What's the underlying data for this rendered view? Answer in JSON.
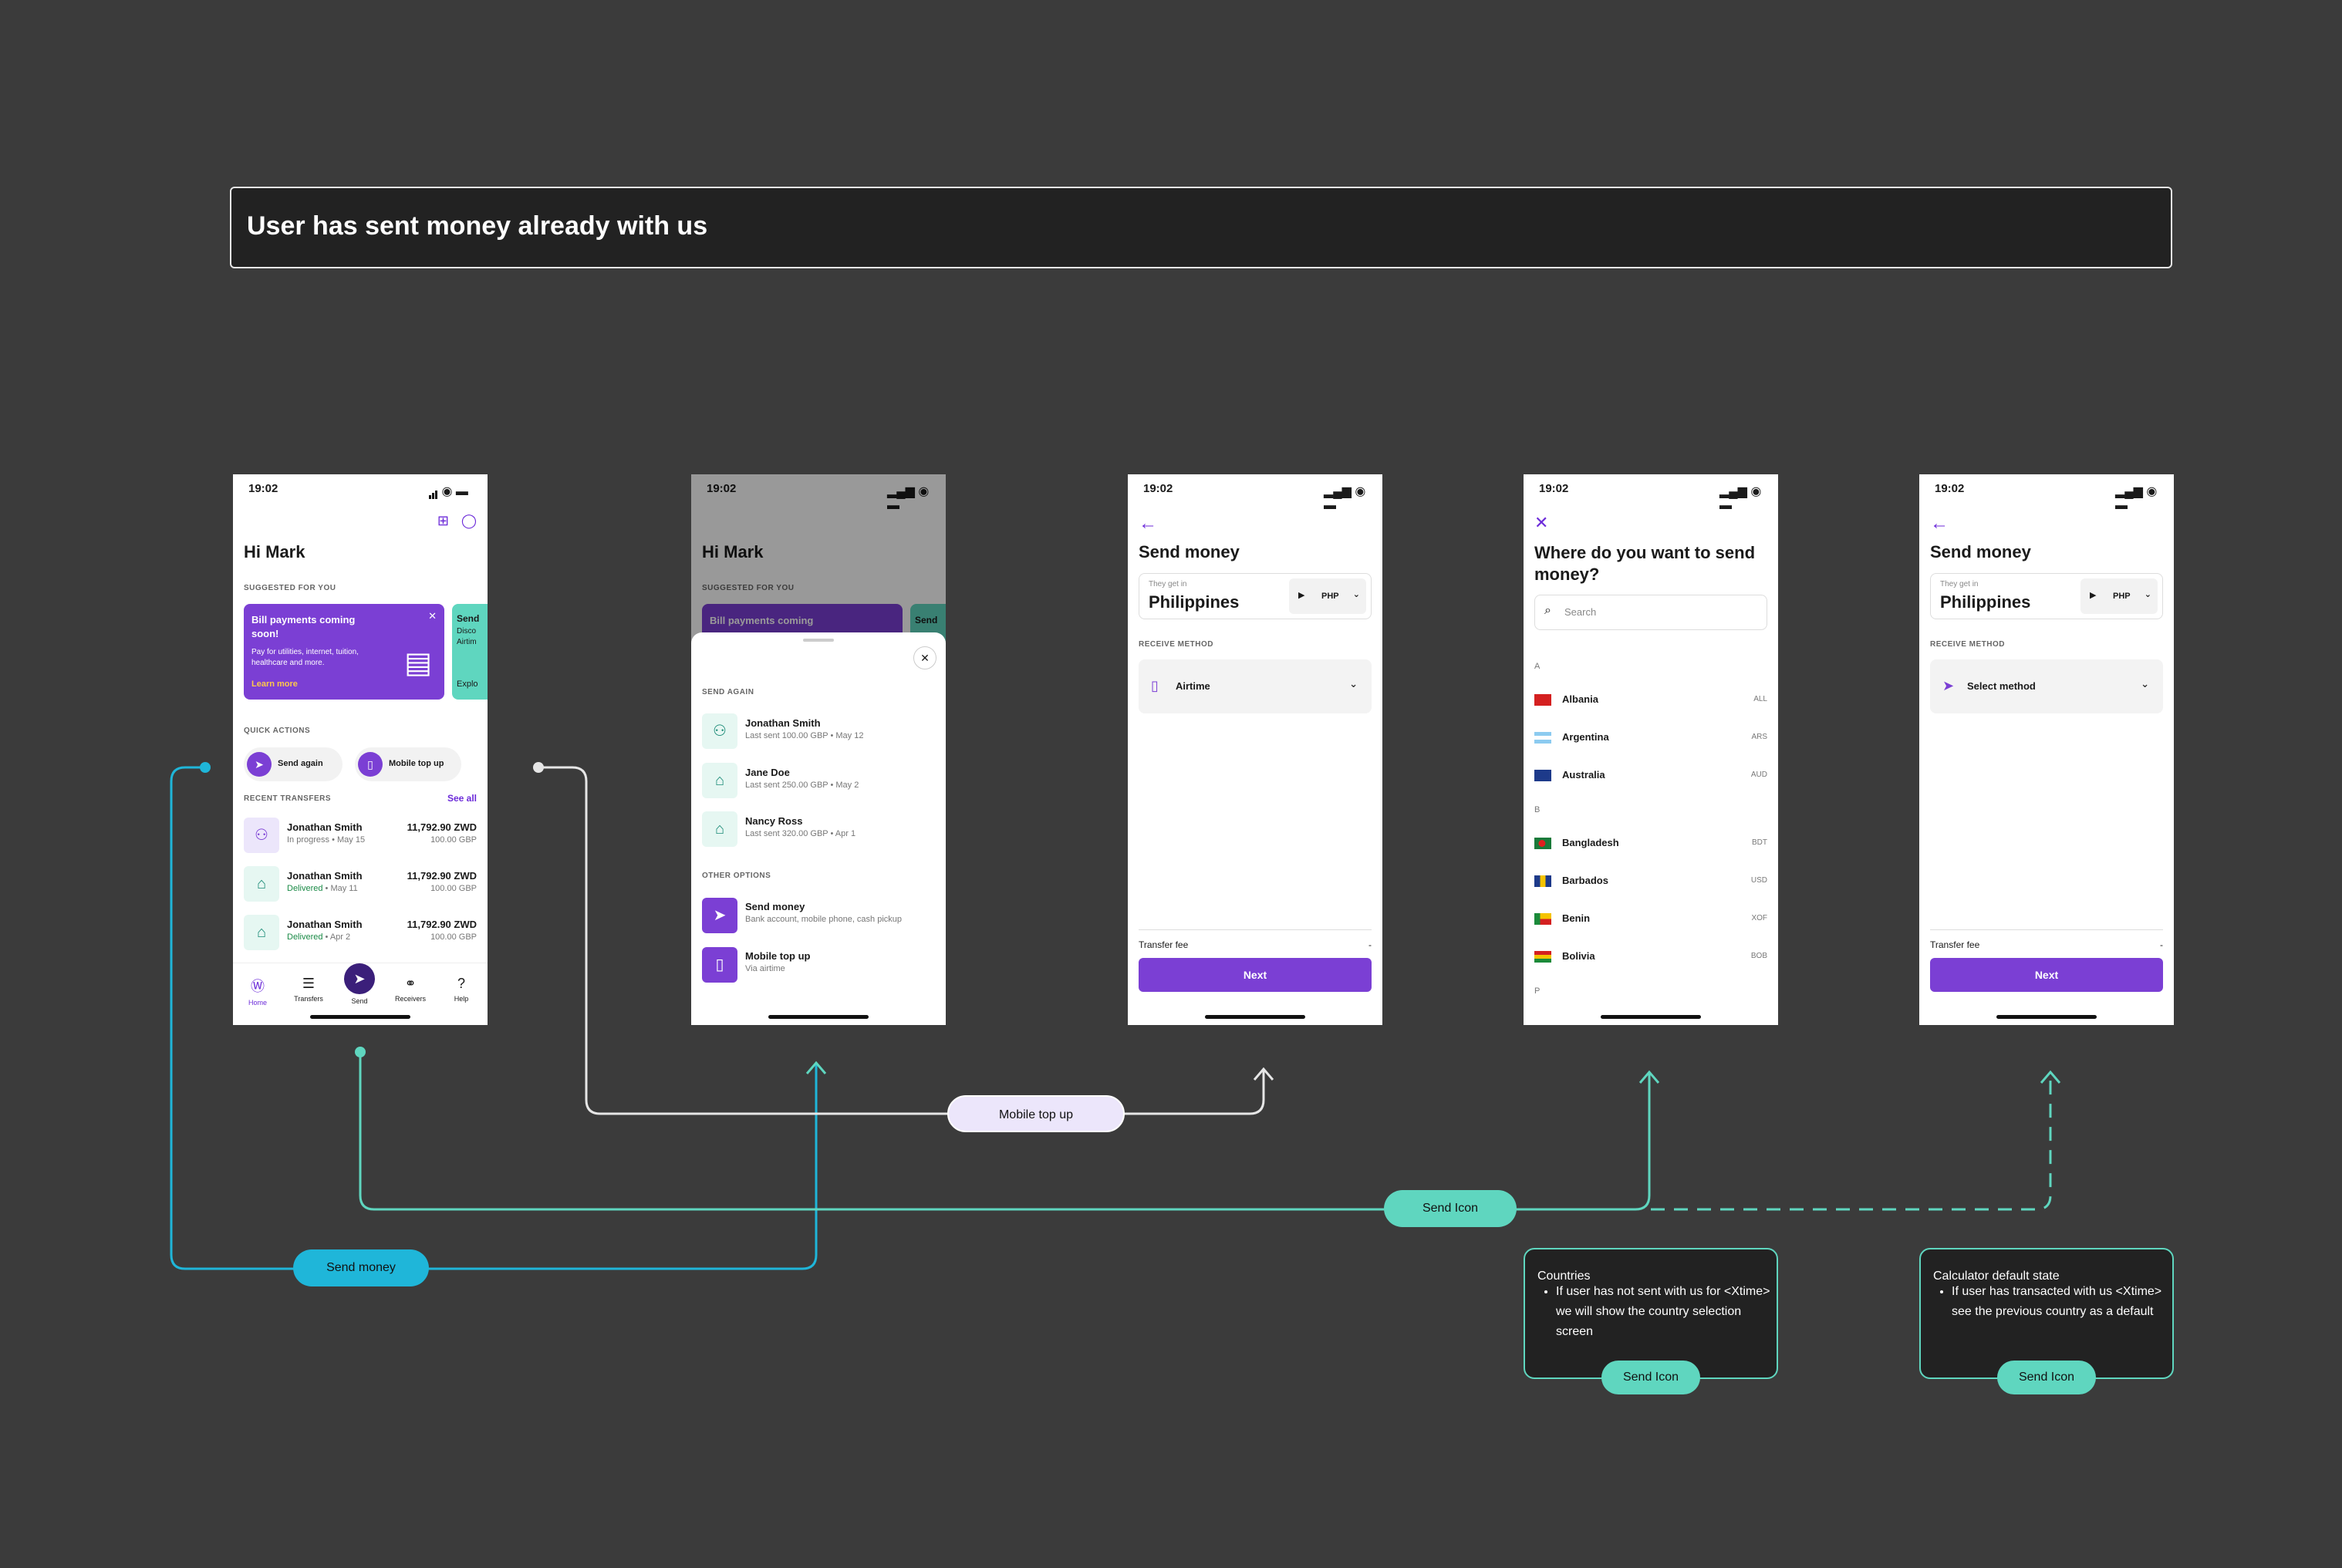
{
  "banner": {
    "title": "User has sent money already with us"
  },
  "status": {
    "time": "19:02"
  },
  "home": {
    "greeting": "Hi Mark",
    "suggested_label": "SUGGESTED FOR YOU",
    "promo": {
      "title": "Bill payments coming soon!",
      "body": "Pay for utilities, internet, tuition, healthcare and more.",
      "link": "Learn more"
    },
    "promo2": {
      "title": "Send",
      "line1": "Disco",
      "line2": "Airtim",
      "link": "Explo"
    },
    "quick_actions_label": "QUICK ACTIONS",
    "quick_actions": [
      {
        "label": "Send again"
      },
      {
        "label": "Mobile top up"
      }
    ],
    "recent_label": "RECENT TRANSFERS",
    "see_all": "See all",
    "transfers": [
      {
        "name": "Jonathan Smith",
        "status": "In progress",
        "date": "May 15",
        "amount": "11,792.90 ZWD",
        "sent": "100.00 GBP"
      },
      {
        "name": "Jonathan Smith",
        "status": "Delivered",
        "date": "May 11",
        "amount": "11,792.90 ZWD",
        "sent": "100.00 GBP"
      },
      {
        "name": "Jonathan Smith",
        "status": "Delivered",
        "date": "Apr 2",
        "amount": "11,792.90 ZWD",
        "sent": "100.00 GBP"
      }
    ],
    "nav": [
      {
        "label": "Home"
      },
      {
        "label": "Transfers"
      },
      {
        "label": "Send"
      },
      {
        "label": "Receivers"
      },
      {
        "label": "Help"
      }
    ]
  },
  "sheet": {
    "promo_title": "Bill payments coming",
    "promo2_title": "Send",
    "send_again_label": "SEND AGAIN",
    "recipients": [
      {
        "name": "Jonathan Smith",
        "detail": "Last sent 100.00 GBP • May 12"
      },
      {
        "name": "Jane Doe",
        "detail": "Last sent 250.00 GBP • May 2"
      },
      {
        "name": "Nancy Ross",
        "detail": "Last sent 320.00 GBP • Apr 1"
      }
    ],
    "other_label": "OTHER OPTIONS",
    "options": [
      {
        "name": "Send money",
        "detail": "Bank account, mobile phone, cash pickup"
      },
      {
        "name": "Mobile top up",
        "detail": "Via airtime"
      }
    ]
  },
  "send_airtime": {
    "title": "Send money",
    "they_get": "They get in",
    "country": "Philippines",
    "currency": "PHP",
    "receive_label": "RECEIVE METHOD",
    "method": "Airtime",
    "fee_label": "Transfer fee",
    "fee_value": "-",
    "next": "Next"
  },
  "countries": {
    "title": "Where do you want to send money?",
    "search_placeholder": "Search",
    "groups": [
      {
        "letter": "A",
        "items": [
          {
            "name": "Albania",
            "code": "ALL"
          },
          {
            "name": "Argentina",
            "code": "ARS"
          },
          {
            "name": "Australia",
            "code": "AUD"
          }
        ]
      },
      {
        "letter": "B",
        "items": [
          {
            "name": "Bangladesh",
            "code": "BDT"
          },
          {
            "name": "Barbados",
            "code": "USD"
          },
          {
            "name": "Benin",
            "code": "XOF"
          },
          {
            "name": "Bolivia",
            "code": "BOB"
          }
        ]
      },
      {
        "letter": "P",
        "items": []
      }
    ]
  },
  "send_default": {
    "title": "Send money",
    "they_get": "They get in",
    "country": "Philippines",
    "currency": "PHP",
    "receive_label": "RECEIVE METHOD",
    "method": "Select method",
    "fee_label": "Transfer fee",
    "fee_value": "-",
    "next": "Next"
  },
  "tags": {
    "mobile_top_up": "Mobile top up",
    "send_icon": "Send Icon",
    "send_money": "Send money"
  },
  "notes": {
    "countries": {
      "title": "Countries",
      "bullet": "If user has not sent with us for <Xtime> we will show the country selection screen",
      "tag": "Send Icon"
    },
    "calculator": {
      "title": "Calculator default state",
      "bullet": "If user has transacted with us <Xtime> see the previous country as a default",
      "tag": "Send Icon"
    }
  },
  "colors": {
    "accent": "#7b3fd4",
    "teal": "#5fd6bf",
    "cyan": "#1fb6d9",
    "lavender": "#ece6fb"
  }
}
